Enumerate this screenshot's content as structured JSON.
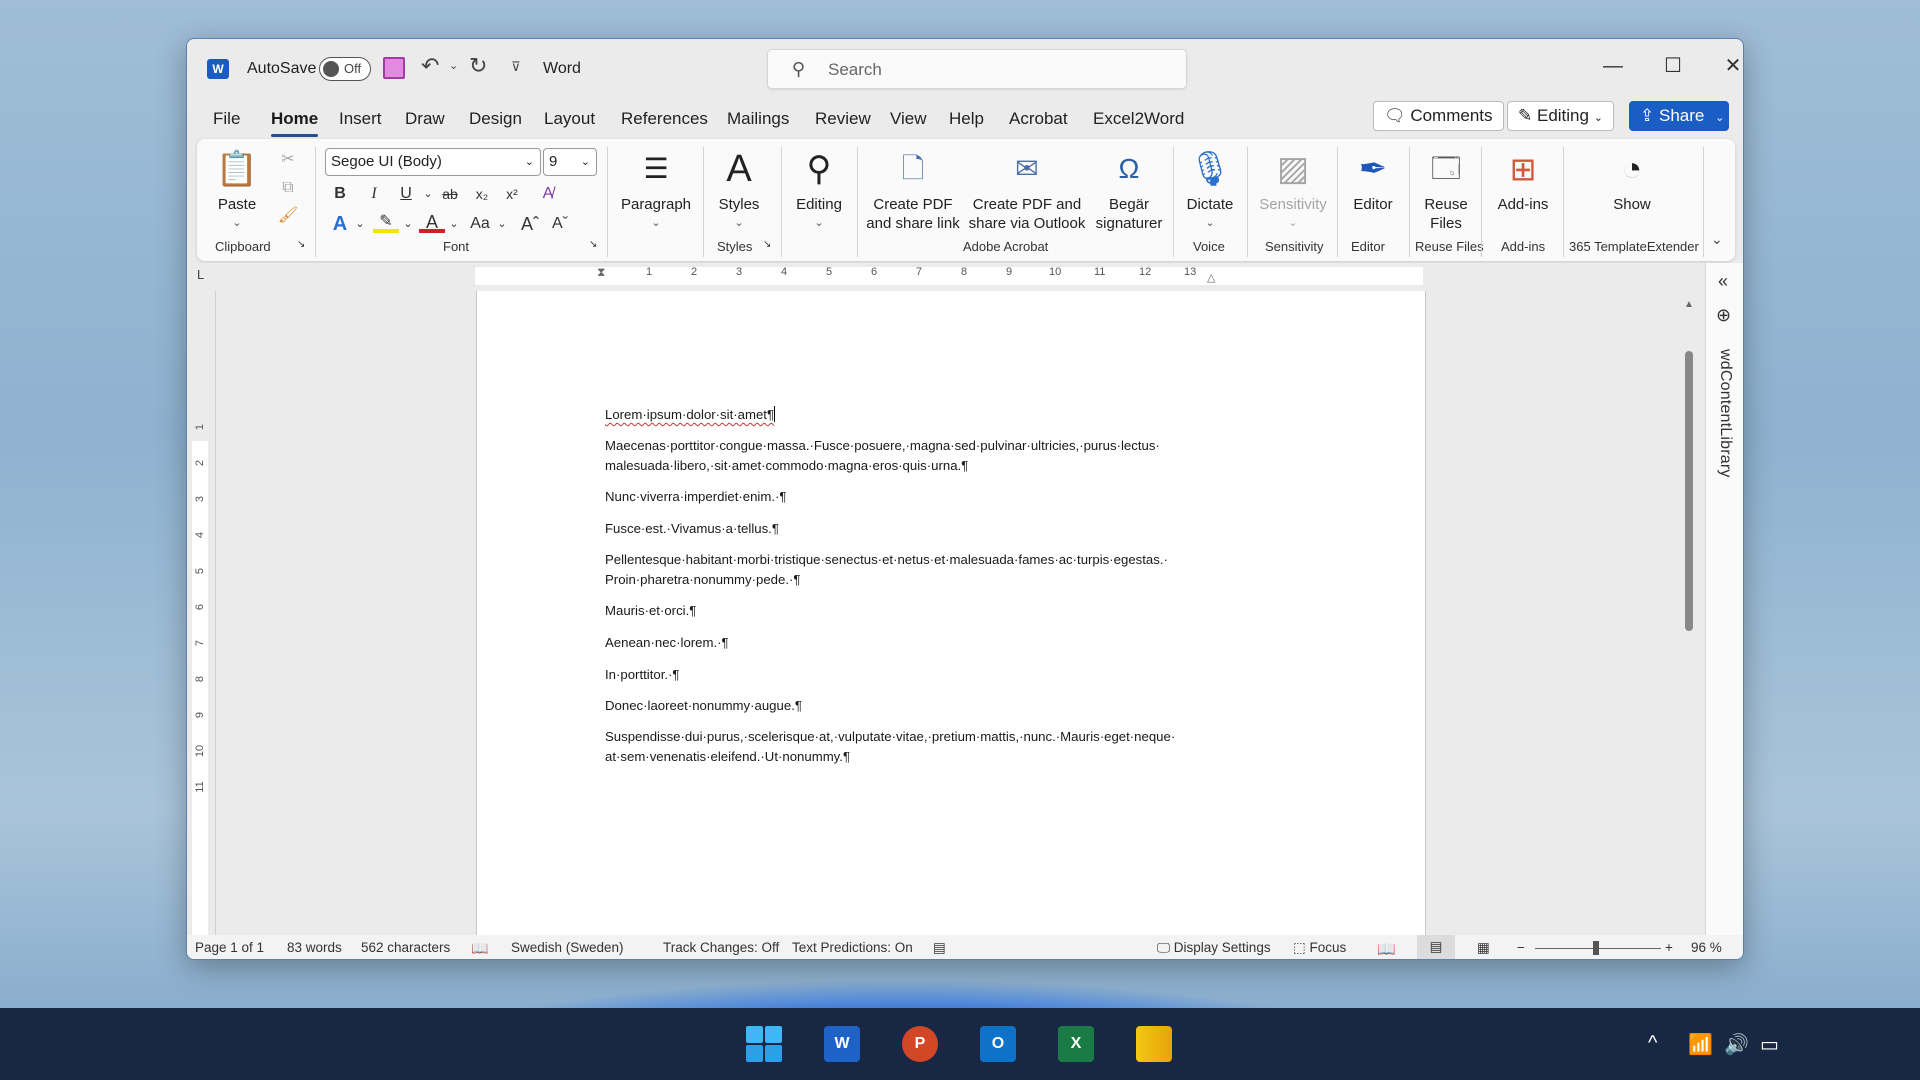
{
  "titlebar": {
    "app_icon": "word-logo-icon",
    "autosave_label": "AutoSave",
    "autosave_state": "Off",
    "app_name": "Word",
    "search_placeholder": "Search",
    "window_controls": [
      "minimize",
      "maximize",
      "close"
    ]
  },
  "tabs": [
    {
      "label": "File"
    },
    {
      "label": "Home",
      "active": true
    },
    {
      "label": "Insert"
    },
    {
      "label": "Draw"
    },
    {
      "label": "Design"
    },
    {
      "label": "Layout"
    },
    {
      "label": "References"
    },
    {
      "label": "Mailings"
    },
    {
      "label": "Review"
    },
    {
      "label": "View"
    },
    {
      "label": "Help"
    },
    {
      "label": "Acrobat"
    },
    {
      "label": "Excel2Word"
    }
  ],
  "header_buttons": {
    "comments": "Comments",
    "editing": "Editing",
    "share": "Share"
  },
  "ribbon": {
    "clipboard": {
      "paste": "Paste",
      "group": "Clipboard"
    },
    "font": {
      "name": "Segoe UI (Body)",
      "size": "9",
      "group": "Font",
      "buttons": [
        "Bold",
        "Italic",
        "Underline",
        "Strikethrough",
        "Subscript",
        "Superscript",
        "Clear Formatting",
        "Text Effects",
        "Highlight",
        "Font Color",
        "Change Case",
        "Grow Font",
        "Shrink Font"
      ]
    },
    "paragraph": {
      "label": "Paragraph"
    },
    "styles": {
      "label": "Styles",
      "group": "Styles"
    },
    "editing": {
      "label": "Editing"
    },
    "acrobat": {
      "create_pdf_link": [
        "Create PDF",
        "and share link"
      ],
      "create_pdf_outlook": [
        "Create PDF and",
        "share via Outlook"
      ],
      "request_sign": [
        "Begär",
        "signaturer"
      ],
      "group": "Adobe Acrobat"
    },
    "voice": {
      "label": "Dictate",
      "group": "Voice"
    },
    "sensitivity": {
      "label": "Sensitivity",
      "group": "Sensitivity"
    },
    "editor": {
      "label": "Editor",
      "group": "Editor"
    },
    "reuse": {
      "label": [
        "Reuse",
        "Files"
      ],
      "group": "Reuse Files"
    },
    "addins": {
      "label": "Add-ins",
      "group": "Add-ins"
    },
    "template": {
      "label": "Show",
      "group": "365 TemplateExtender"
    }
  },
  "ruler": {
    "h_ticks": [
      "1",
      "2",
      "3",
      "4",
      "5",
      "6",
      "7",
      "8",
      "9",
      "10",
      "11",
      "12",
      "13"
    ],
    "v_ticks": [
      "1",
      "2",
      "3",
      "4",
      "5",
      "6",
      "7",
      "8",
      "9",
      "10",
      "11"
    ]
  },
  "document": {
    "paragraphs": [
      "Lorem·ipsum·dolor·sit·amet¶",
      "Maecenas·porttitor·congue·massa.·Fusce·posuere,·magna·sed·pulvinar·ultricies,·purus·lectus· malesuada·libero,·sit·amet·commodo·magna·eros·quis·urna.¶",
      "Nunc·viverra·imperdiet·enim.·¶",
      "Fusce·est.·Vivamus·a·tellus.¶",
      "Pellentesque·habitant·morbi·tristique·senectus·et·netus·et·malesuada·fames·ac·turpis·egestas.· Proin·pharetra·nonummy·pede.·¶",
      "Mauris·et·orci.¶",
      "Aenean·nec·lorem.·¶",
      "In·porttitor.·¶",
      "Donec·laoreet·nonummy·augue.¶",
      "Suspendisse·dui·purus,·scelerisque·at,·vulputate·vitae,·pretium·mattis,·nunc.·Mauris·eget·neque· at·sem·venenatis·eleifend.·Ut·nonummy.¶"
    ]
  },
  "side_pane": {
    "label": "wdContentLibrary"
  },
  "status": {
    "page": "Page 1 of 1",
    "words": "83 words",
    "characters": "562 characters",
    "language": "Swedish (Sweden)",
    "track_changes": "Track Changes: Off",
    "text_predictions": "Text Predictions: On",
    "display_settings": "Display Settings",
    "focus": "Focus",
    "zoom": "96 %",
    "zoom_value_percent": 96
  },
  "taskbar": {
    "apps": [
      "Start",
      "Word",
      "PowerPoint",
      "Outlook",
      "Excel",
      "Power BI"
    ],
    "tray": [
      "show-hidden-icons",
      "wifi",
      "volume",
      "battery"
    ]
  },
  "colors": {
    "accent": "#1a5dc4",
    "squiggle": "#d13438"
  }
}
